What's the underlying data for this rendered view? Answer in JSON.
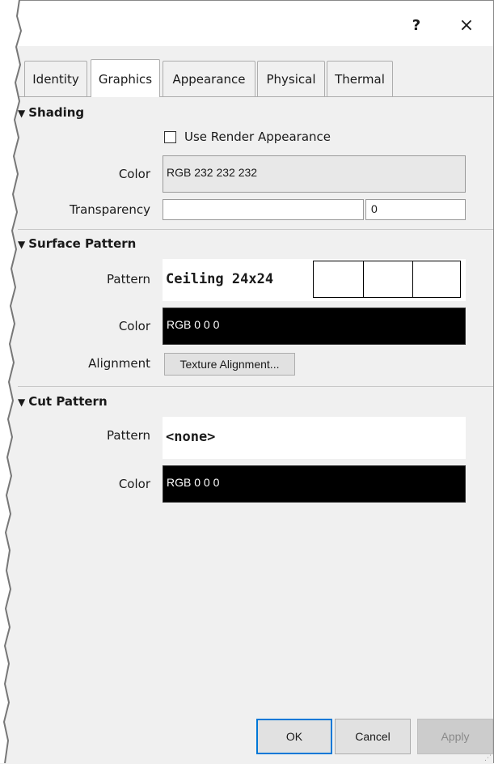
{
  "titlebar": {
    "help_label": "?",
    "close_label": "×"
  },
  "tabs": [
    {
      "label": "Identity",
      "active": false
    },
    {
      "label": "Graphics",
      "active": true
    },
    {
      "label": "Appearance",
      "active": false
    },
    {
      "label": "Physical",
      "active": false
    },
    {
      "label": "Thermal",
      "active": false
    }
  ],
  "shading": {
    "header": "Shading",
    "use_render_label": "Use Render Appearance",
    "use_render_checked": false,
    "color_label": "Color",
    "color_value": "RGB 232 232 232",
    "color_hex": "#e8e8e8",
    "transparency_label": "Transparency",
    "transparency_value": "0"
  },
  "surface_pattern": {
    "header": "Surface Pattern",
    "pattern_label": "Pattern",
    "pattern_value": "Ceiling 24x24",
    "color_label": "Color",
    "color_value": "RGB 0 0 0",
    "color_hex": "#000000",
    "alignment_label": "Alignment",
    "alignment_button": "Texture Alignment..."
  },
  "cut_pattern": {
    "header": "Cut Pattern",
    "pattern_label": "Pattern",
    "pattern_value": "<none>",
    "color_label": "Color",
    "color_value": "RGB 0 0 0",
    "color_hex": "#000000"
  },
  "footer": {
    "ok_label": "OK",
    "cancel_label": "Cancel",
    "apply_label": "Apply",
    "apply_enabled": false
  },
  "icons": {
    "expand_arrow": "triangle-down-icon"
  }
}
